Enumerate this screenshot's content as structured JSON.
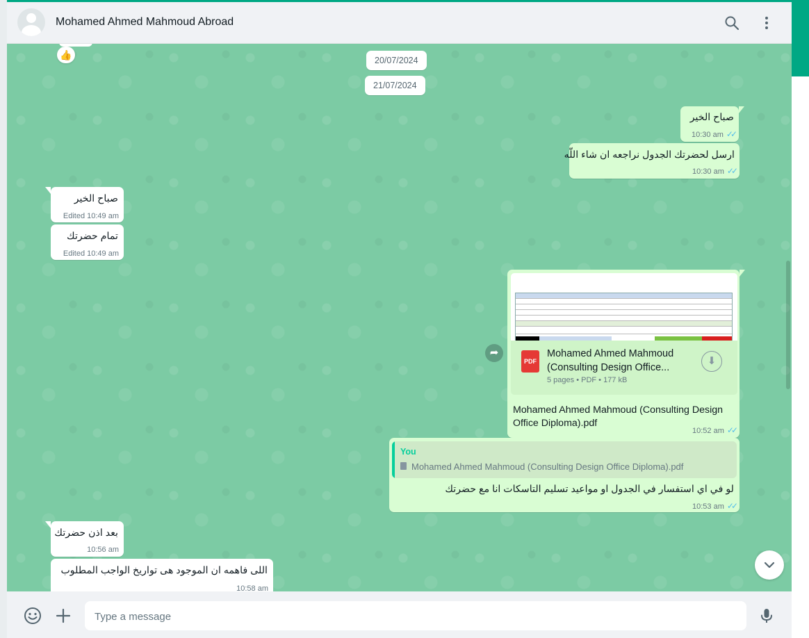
{
  "header": {
    "contact_name": "Mohamed Ahmed Mahmoud Abroad",
    "icons": [
      "search-icon",
      "menu-icon"
    ]
  },
  "reaction": {
    "emoji": "👍"
  },
  "dates": [
    "20/07/2024",
    "21/07/2024"
  ],
  "messages": [
    {
      "dir": "out",
      "text": "صباح الخير",
      "time": "10:30 am",
      "status": "read"
    },
    {
      "dir": "out",
      "text": "ارسل لحضرتك الجدول نراجعه ان شاء اللّه",
      "time": "10:30 am",
      "status": "read"
    },
    {
      "dir": "in",
      "text": "صباح الخير",
      "time": "Edited 10:49 am"
    },
    {
      "dir": "in",
      "text": "تمام حضرتك",
      "time": "Edited 10:49 am"
    },
    {
      "dir": "out",
      "type": "document",
      "doc_title_line1": "Mohamed Ahmed Mahmoud",
      "doc_title_line2": "(Consulting Design Office...",
      "doc_meta": "5 pages • PDF • 177 kB",
      "caption_line1": "Mohamed Ahmed Mahmoud (Consulting Design",
      "caption_line2": "Office Diploma).pdf",
      "time": "10:52 am",
      "status": "read"
    },
    {
      "dir": "out",
      "type": "reply",
      "quote_author": "You",
      "quote_text": "Mohamed Ahmed Mahmoud (Consulting Design Office Diploma).pdf",
      "text": "لو في اي استفسار في الجدول او مواعيد تسليم التاسكات انا مع حضرتك",
      "time": "10:53 am",
      "status": "read"
    },
    {
      "dir": "in",
      "text": "بعد اذن حضرتك",
      "time": "10:56 am"
    },
    {
      "dir": "in",
      "text": "اللى فاهمه  ان الموجود  هى تواريخ الواجب المطلوب",
      "time": "10:58 am"
    }
  ],
  "composer": {
    "placeholder": "Type a message"
  },
  "colors": {
    "accent": "#00a884",
    "outgoing_bubble": "#d9fdd3",
    "incoming_bubble": "#ffffff",
    "read_ticks": "#53bdeb",
    "chat_background": "#7ccba4"
  }
}
